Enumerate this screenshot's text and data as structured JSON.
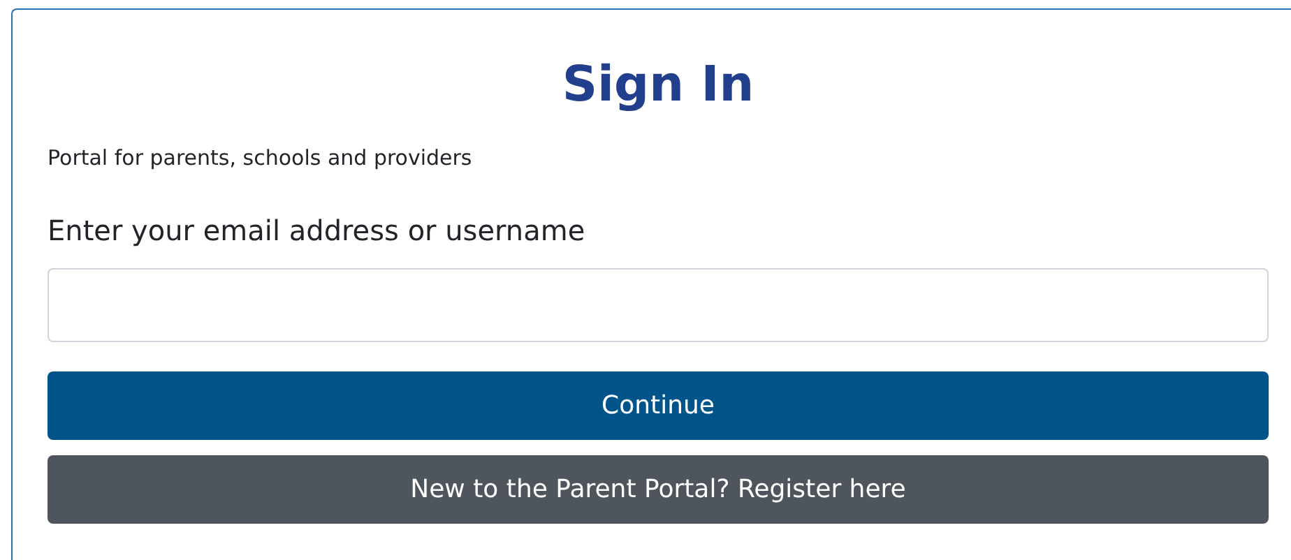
{
  "title": "Sign In",
  "subtitle": "Portal for parents, schools and providers",
  "email_field": {
    "label": "Enter your email address or username"
  },
  "buttons": [
    {
      "label": "Continue",
      "kind": "primary"
    },
    {
      "label": "New to the Parent Portal? Register here",
      "kind": "secondary"
    }
  ]
}
